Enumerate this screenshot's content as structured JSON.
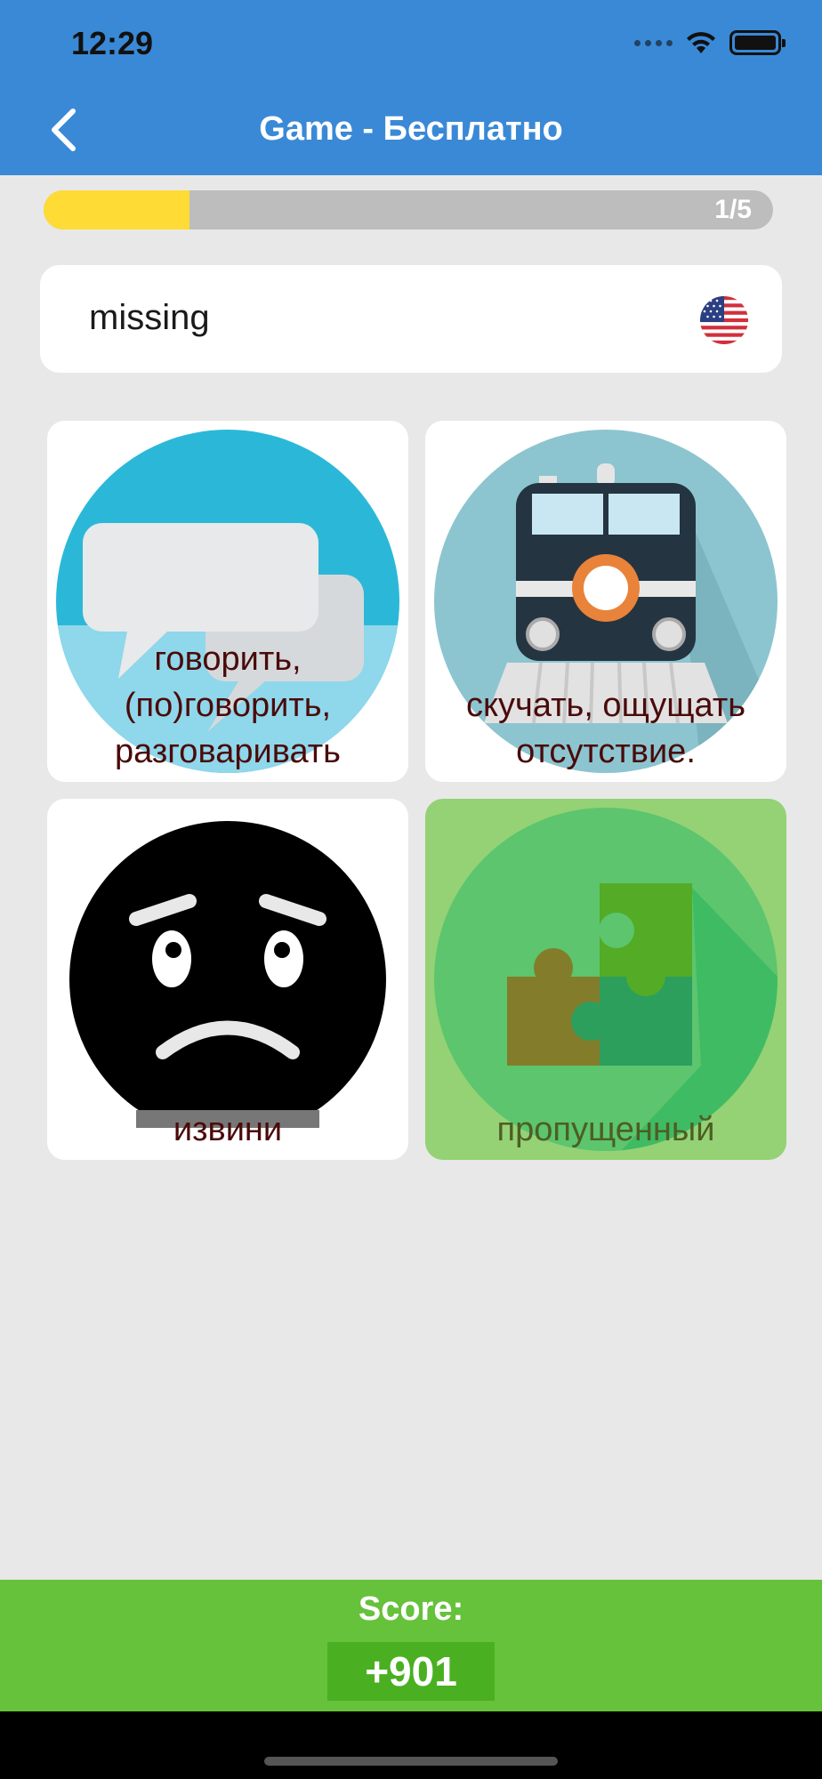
{
  "status_bar": {
    "time": "12:29"
  },
  "header": {
    "title": "Game - Бесплатно"
  },
  "progress": {
    "label": "1/5",
    "fraction": 0.2
  },
  "question": {
    "word": "missing",
    "flag_icon": "us-flag-icon"
  },
  "options": [
    {
      "label": "говорить, (по)говорить, разговаривать",
      "icon": "speech-bubbles-icon",
      "selected": false
    },
    {
      "label": "скучать, ощущать отсутствие.",
      "icon": "train-icon",
      "selected": false
    },
    {
      "label": "извини",
      "icon": "sad-face-icon",
      "selected": false
    },
    {
      "label": "пропущенный",
      "icon": "puzzle-icon",
      "selected": true
    }
  ],
  "score": {
    "label": "Score:",
    "value": "+901"
  },
  "colors": {
    "header": "#3a89d6",
    "progress_fill": "#fedb35",
    "score_bar": "#66c13b",
    "selected_tile": "#94d275"
  }
}
